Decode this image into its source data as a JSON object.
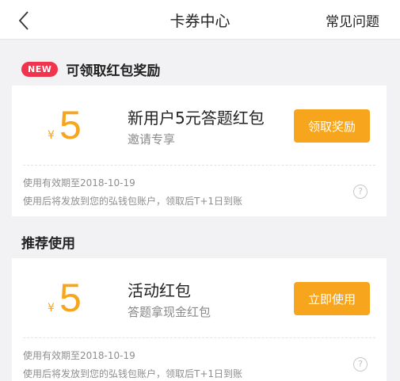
{
  "nav": {
    "back_icon": "chevron-left-icon",
    "title": "卡券中心",
    "faq": "常见问题"
  },
  "section1": {
    "badge": "NEW",
    "title": "可领取红包奖励"
  },
  "section2": {
    "title": "推荐使用"
  },
  "cards": [
    {
      "currency": "¥",
      "amount": "5",
      "title": "新用户5元答题红包",
      "subtitle": "邀请专享",
      "button": "领取奖励",
      "validity": "使用有效期至2018-10-19",
      "note": "使用后将发放到您的弘钱包账户，领取后T+1日到账",
      "help_icon": "help-circle-icon"
    },
    {
      "currency": "¥",
      "amount": "5",
      "title": "活动红包",
      "subtitle": "答题拿现金红包",
      "button": "立即使用",
      "validity": "使用有效期至2018-10-19",
      "note": "使用后将发放到您的弘钱包账户，领取后T+1日到账",
      "help_icon": "help-circle-icon"
    }
  ],
  "colors": {
    "accent": "#f7a51c",
    "badge": "#f0344e",
    "background": "#f2f2f4"
  }
}
